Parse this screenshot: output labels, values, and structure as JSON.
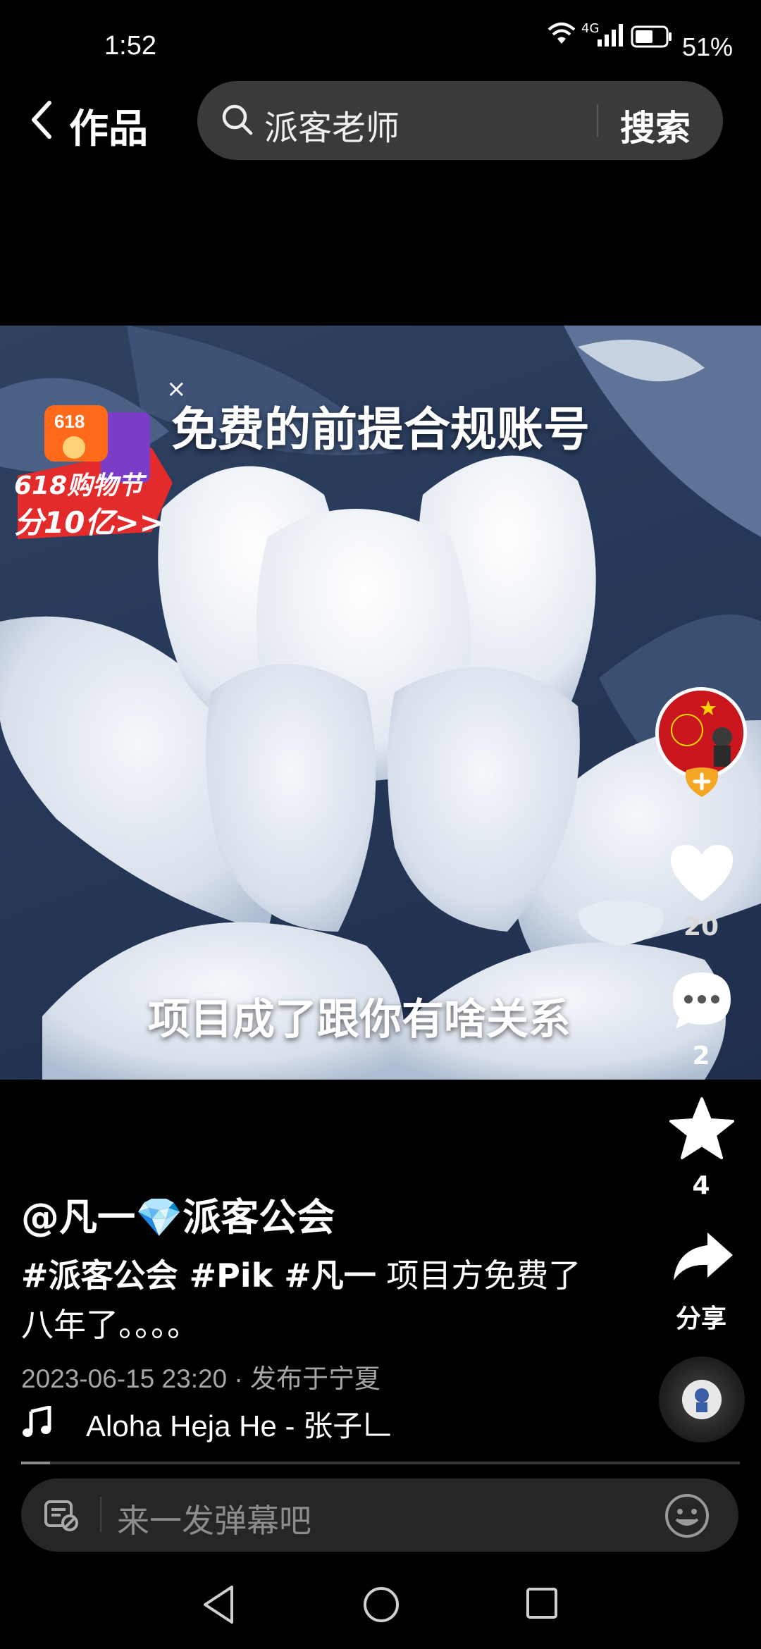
{
  "status_bar": {
    "time": "1:52",
    "network": "4G",
    "battery": "51%"
  },
  "header": {
    "title": "作品",
    "search_query": "派客老师",
    "search_button": "搜索"
  },
  "video": {
    "close_mark": "×",
    "caption_top": "免费的前提合规账号",
    "caption_bottom": "项目成了跟你有啥关系",
    "promo": {
      "badge": "618",
      "line1": "618购物节",
      "line2": "分10亿>>"
    }
  },
  "actions": {
    "like_count": "20",
    "comment_count": "2",
    "favorite_count": "4",
    "share_label": "分享"
  },
  "post": {
    "author": "@凡一💎派客公会",
    "tags": "#派客公会 #Pik #凡一",
    "text_line1": " 项目方免费了",
    "text_line2": "八年了。。。。",
    "meta": "2023-06-15 23:20 · 发布于宁夏",
    "music": "Aloha Heja He - 张子𠃊",
    "progress": 0.04
  },
  "comment_input": {
    "placeholder": "来一发弹幕吧"
  },
  "colors": {
    "background": "#000000",
    "search_bg": "#3a3a3a",
    "input_bg": "#262626",
    "accent_red": "#c9161c"
  }
}
